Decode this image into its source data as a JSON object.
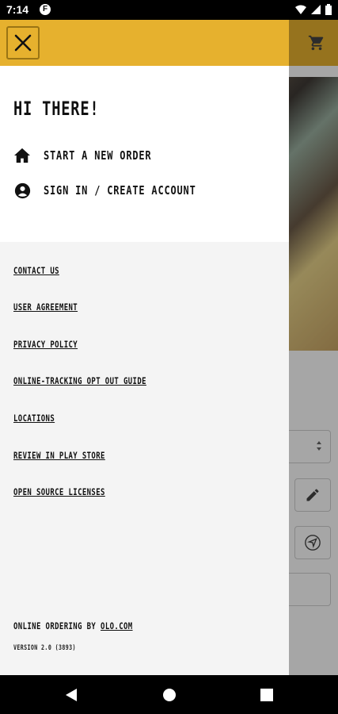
{
  "status_bar": {
    "time": "7:14",
    "notification_badge": "F"
  },
  "drawer": {
    "greeting": "HI THERE!",
    "menu": [
      {
        "label": "START A NEW ORDER",
        "icon": "home-icon"
      },
      {
        "label": "SIGN IN / CREATE ACCOUNT",
        "icon": "account-circle-icon"
      }
    ],
    "links": [
      "CONTACT US",
      "USER AGREEMENT",
      "PRIVACY POLICY",
      "ONLINE-TRACKING OPT OUT GUIDE",
      "LOCATIONS",
      "REVIEW IN PLAY STORE",
      "OPEN SOURCE LICENSES"
    ],
    "footer_prefix": "ONLINE ORDERING BY ",
    "footer_link": "OLO.COM",
    "version": "VERSION 2.0 (3893)"
  },
  "colors": {
    "brand": "#e6b12e",
    "drawer_bg": "#f4f4f4"
  }
}
